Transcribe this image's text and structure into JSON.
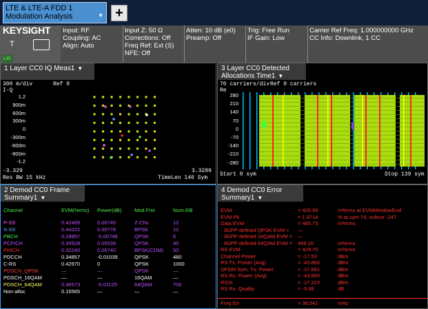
{
  "tab": {
    "title_line1": "LTE & LTE-A FDD 1",
    "title_line2": "Modulation Analysis",
    "add_label": "+"
  },
  "brand": {
    "logo": "KEYSIGHT",
    "t": "T",
    "lxi": "LXI"
  },
  "info": {
    "col1": [
      "Input: RF",
      "Coupling: AC",
      "Align: Auto"
    ],
    "col2": [
      "Input Z: 50 Ω",
      "Corrections: Off",
      "Freq Ref: Ext (S)",
      "NFE: Off"
    ],
    "col3": [
      "Atten: 10 dB (e0)",
      "Preamp: Off"
    ],
    "col4": [
      "Trig: Free Run",
      "IF Gain: Low"
    ],
    "col5": [
      "Carrier Ref Freq: 1.000000000 GHz",
      "CC Info: Downlink, 1 CC"
    ]
  },
  "panel1": {
    "title": "1 Layer CC0 IQ Meas1",
    "scale": "300 m/div",
    "ref": "Ref 0",
    "axis": "I-Q",
    "yticks": [
      "1.2",
      "900m",
      "600m",
      "300m",
      "0",
      "-300m",
      "-600m",
      "-900m",
      "-1.2"
    ],
    "xmin": "-3.329",
    "xmax": "3.3289",
    "res_bw": "Res BW 15 kHz",
    "time_len": "TimeLen 140  Sym"
  },
  "panel3": {
    "title_line1": "3 Layer CC0 Detected",
    "title_line2": "Allocations Time1",
    "scale": "70  carriers/div",
    "ref": "Ref 0 carriers",
    "axis": "Re",
    "yticks": [
      "280",
      "210",
      "140",
      "70",
      "0",
      "-70",
      "-140",
      "-210",
      "-280"
    ],
    "start": "Start 0  sym",
    "stop": "Stop 139  sym"
  },
  "panel2": {
    "title_line1": "2 Demod CC0 Frame",
    "title_line2": "Summary1",
    "headers": [
      "Channel",
      "EVM(%rms)",
      "Power(dB)",
      "Mod.Fmt",
      "Num.RB"
    ],
    "rows": [
      {
        "ch": "P-SS",
        "evm": "0.42489",
        "pwr": "0.00740",
        "mod": "Z-Chu",
        "rb": "12",
        "color": "#ff55ff"
      },
      {
        "ch": "S-SS",
        "evm": "0.44222",
        "pwr": "0.00778",
        "mod": "BPSK",
        "rb": "12",
        "color": "#6aa0ff"
      },
      {
        "ch": "PBCH",
        "evm": "0.29857",
        "pwr": "-0.00748",
        "mod": "QPSK",
        "rb": "6",
        "color": "#4ef04e"
      },
      {
        "ch": "PCFICH",
        "evm": "0.34528",
        "pwr": "0.05536",
        "mod": "QPSK",
        "rb": "40",
        "color": "#c050ff"
      },
      {
        "ch": "PHICH",
        "evm": "0.32240",
        "pwr": "0.06740",
        "mod": "BPSK(CDM)",
        "rb": "50",
        "color": "#ff3030"
      },
      {
        "ch": "PDCCH",
        "evm": "0.34857",
        "pwr": "-0.01039",
        "mod": "QPSK",
        "rb": "480",
        "color": "#ffffff"
      },
      {
        "ch": "C-RS",
        "evm": "0.42970",
        "pwr": "0",
        "mod": "QPSK",
        "rb": "1000",
        "color": "#ffffff"
      },
      {
        "ch": "PDSCH_QPSK",
        "evm": "—",
        "pwr": "—",
        "mod": "QPSK",
        "rb": "—",
        "color": "#ff4040"
      },
      {
        "ch": "PDSCH_16QAM",
        "evm": "—",
        "pwr": "—",
        "mod": "16QAM",
        "rb": "—",
        "color": "#ffffff"
      },
      {
        "ch": "PDSCH_64QAM",
        "evm": "0.46573",
        "pwr": "-0.01125",
        "mod": "64QAM",
        "rb": "700",
        "color": "#ffff60"
      },
      {
        "ch": "Non-alloc",
        "evm": "0.15565",
        "pwr": "—",
        "mod": "—",
        "rb": "—",
        "color": "#ffffff"
      }
    ]
  },
  "panel4": {
    "title_line1": "4 Demod CC0 Error",
    "title_line2": "Summary1",
    "rows": [
      {
        "label": "EVM",
        "value": "=  426.99",
        "unit": "m%rms at   EVMWindowEnd",
        "color": "#ff3030"
      },
      {
        "label": "EVM Pk",
        "value": "=  1.6714",
        "unit": "          % at  sym 74,  subcar -247",
        "color": "#ff3030"
      },
      {
        "label": "Data EVM",
        "value": "=  465.73",
        "unit": "m%rms",
        "color": "#ff3030"
      },
      {
        "label": "  - 3GPP-defined QPSK EVM =",
        "value": "—",
        "unit": "",
        "color": "#ff3030"
      },
      {
        "label": "  - 3GPP-defined 16QAM EVM =",
        "value": "—",
        "unit": "",
        "color": "#ff3030"
      },
      {
        "label": "  - 3GPP-defined 64QAM EVM =",
        "value": "466.10",
        "unit": "m%rms",
        "color": "#ff3030"
      },
      {
        "label": "RS EVM",
        "value": "=  429.70",
        "unit": "m%rms",
        "color": "#ff3030"
      },
      {
        "label": "Channel Power",
        "value": "=  -17.53",
        "unit": "dBm",
        "color": "#ff3030"
      },
      {
        "label": "RS Tx. Power (Avg)",
        "value": "=  -43.893",
        "unit": "dBm",
        "color": "#ff3030"
      },
      {
        "label": "OFDM Sym. Tx. Power",
        "value": "=  -17.661",
        "unit": "dBm",
        "color": "#ff3030"
      },
      {
        "label": "RS Rx. Power (Avg)",
        "value": "=  -43.893",
        "unit": "dBm",
        "color": "#ff3030"
      },
      {
        "label": "RSSI",
        "value": "=  -17.223",
        "unit": "dBm",
        "color": "#ff3030"
      },
      {
        "label": "RS Rx. Quality",
        "value": "=  -9.68",
        "unit": "dB",
        "color": "#ff3030"
      },
      {
        "label": "Freq Err",
        "value": "=  38.541",
        "unit": "mHz",
        "color": "#ff3030"
      }
    ]
  }
}
